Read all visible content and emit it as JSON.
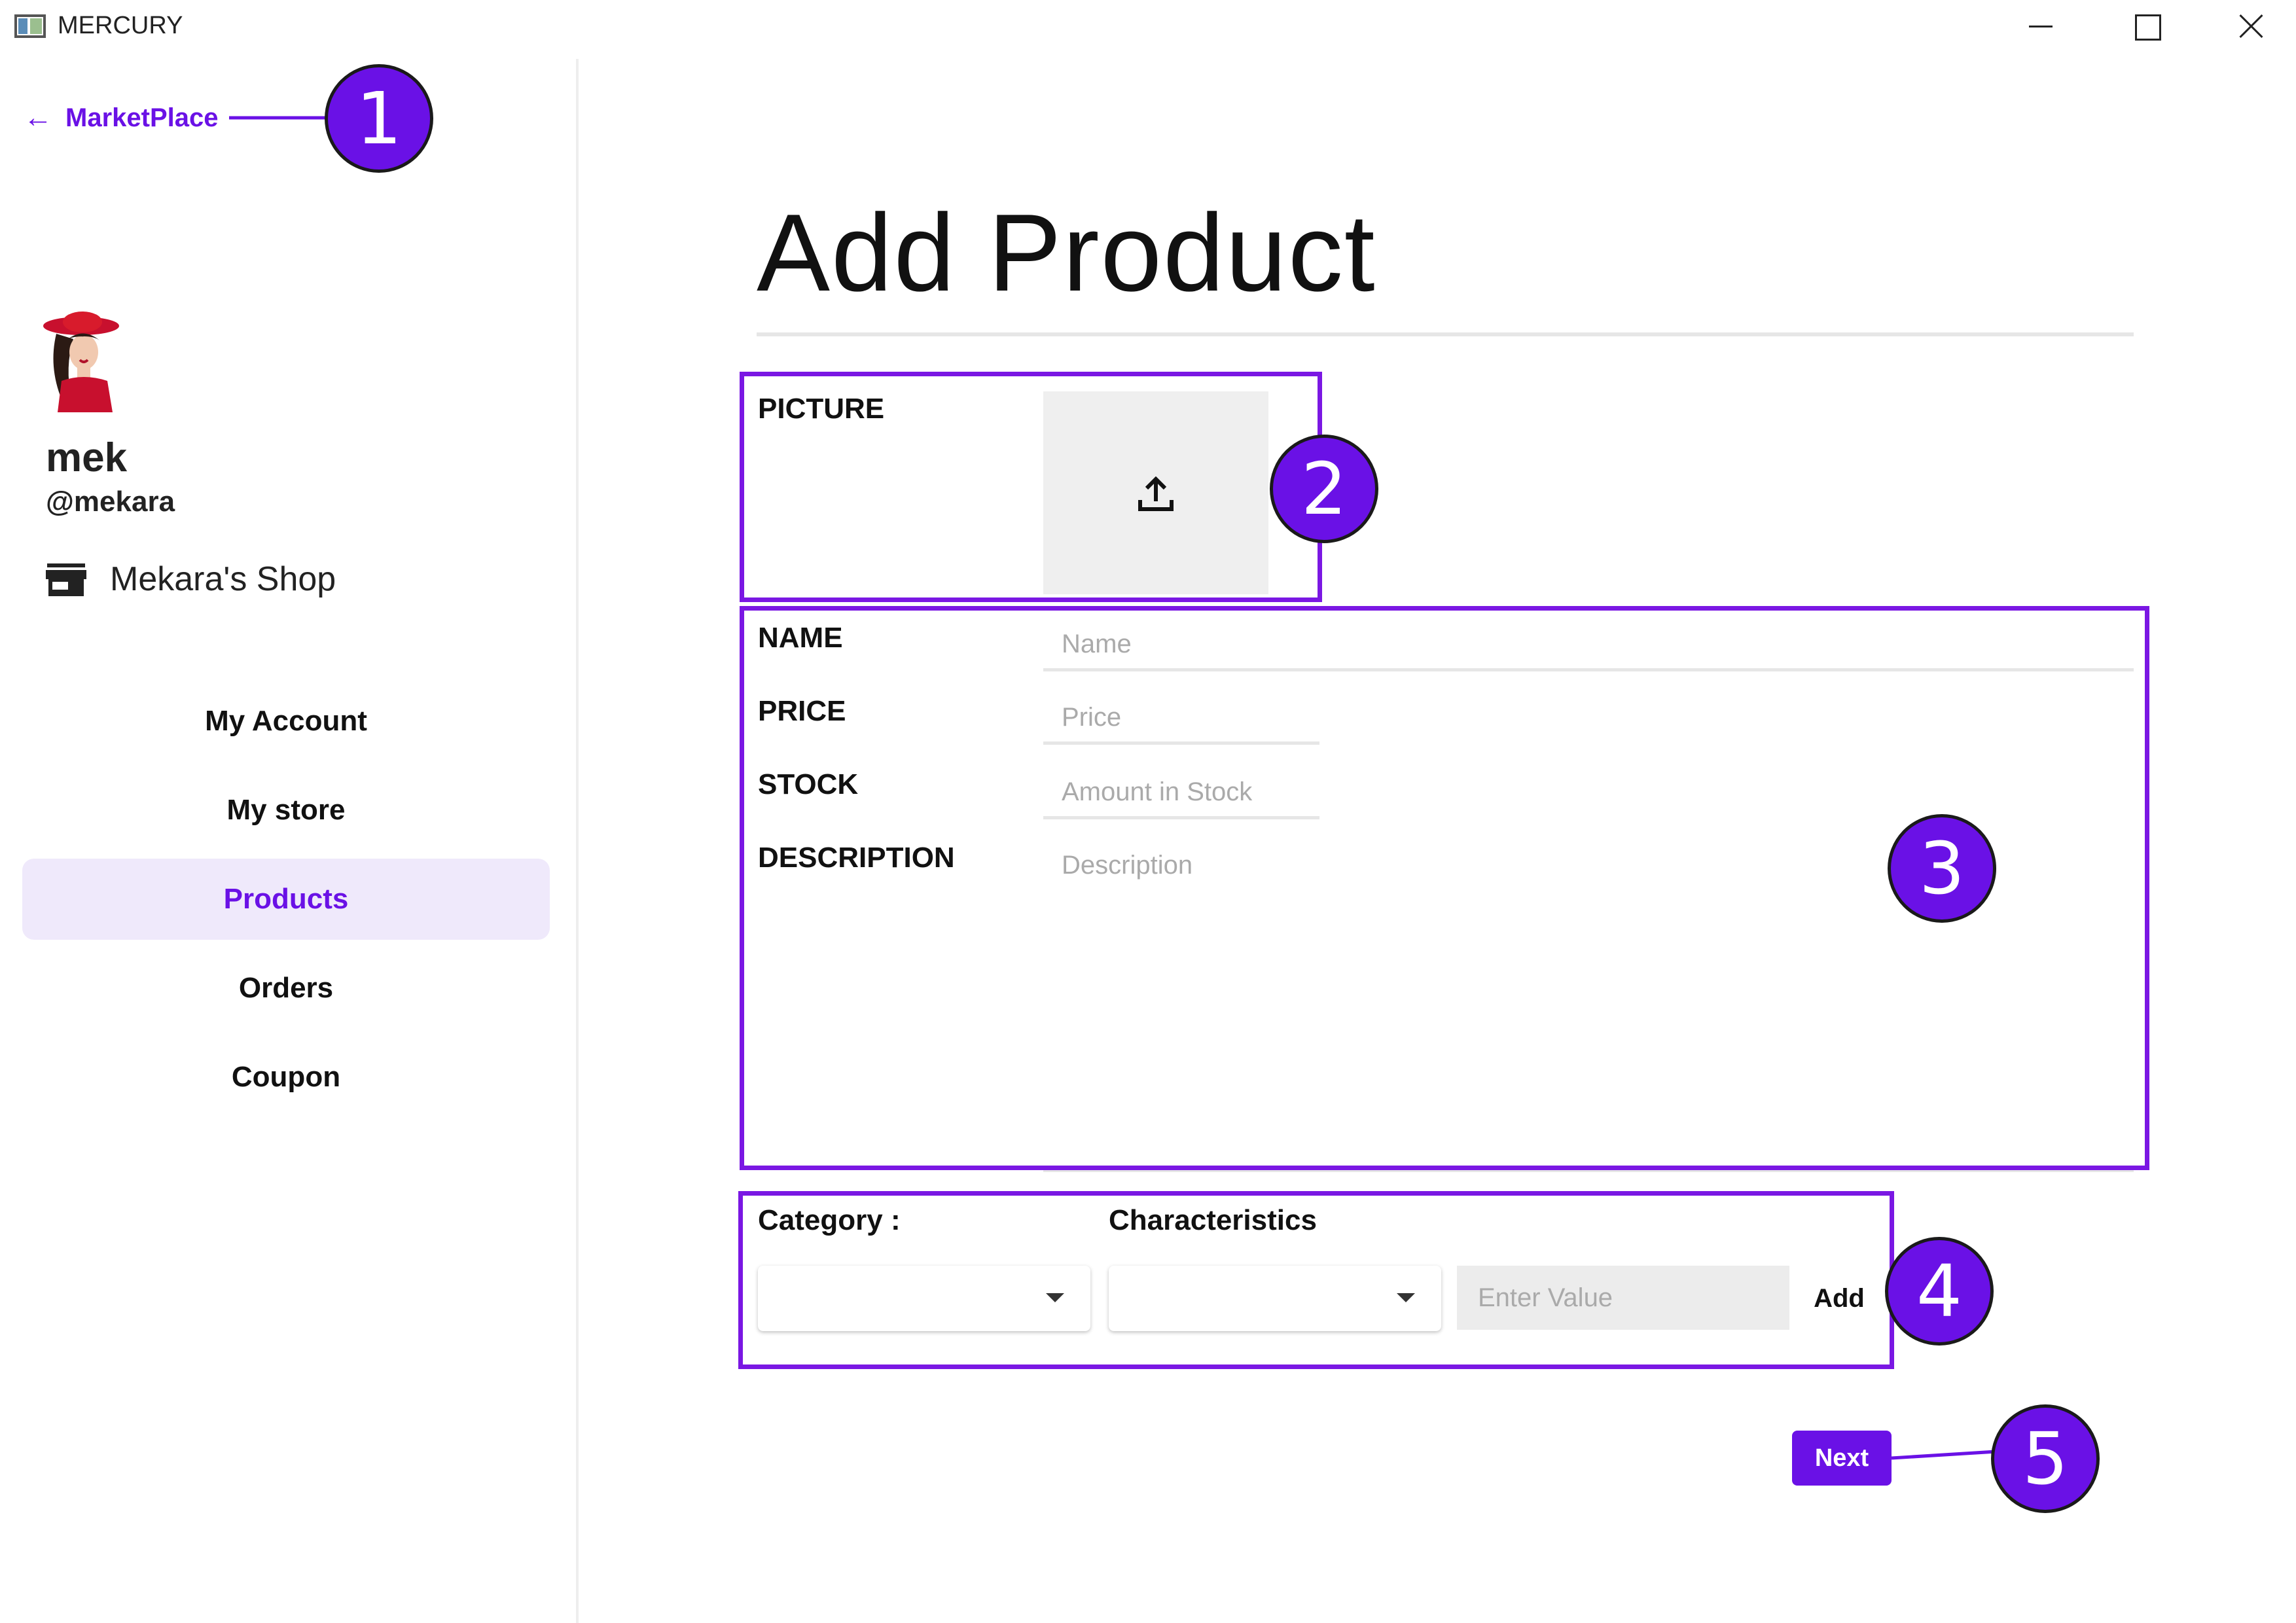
{
  "window": {
    "title": "MERCURY"
  },
  "sidebar": {
    "back_label": "MarketPlace",
    "user": {
      "name": "mek",
      "handle": "@mekara"
    },
    "store_name": "Mekara's Shop",
    "nav": [
      {
        "label": "My Account",
        "active": false
      },
      {
        "label": "My store",
        "active": false
      },
      {
        "label": "Products",
        "active": true
      },
      {
        "label": "Orders",
        "active": false
      },
      {
        "label": "Coupon",
        "active": false
      }
    ]
  },
  "main": {
    "title": "Add Product",
    "picture_label": "PICTURE",
    "fields": {
      "name": {
        "label": "NAME",
        "placeholder": "Name"
      },
      "price": {
        "label": "PRICE",
        "placeholder": "Price"
      },
      "stock": {
        "label": "STOCK",
        "placeholder": "Amount in Stock"
      },
      "description": {
        "label": "DESCRIPTION",
        "placeholder": "Description"
      }
    },
    "category_label": "Category :",
    "characteristics_label": "Characteristics",
    "value_placeholder": "Enter Value",
    "add_label": "Add",
    "next_label": "Next"
  },
  "annotations": {
    "callouts": [
      "1",
      "2",
      "3",
      "4",
      "5"
    ],
    "color": "#7a17e3"
  },
  "colors": {
    "accent": "#6a11e6",
    "active_bg": "#efe9fb",
    "annotation": "#7a17e3"
  },
  "icons": [
    "arrow-left-icon",
    "store-icon",
    "upload-icon",
    "chevron-down-icon"
  ]
}
